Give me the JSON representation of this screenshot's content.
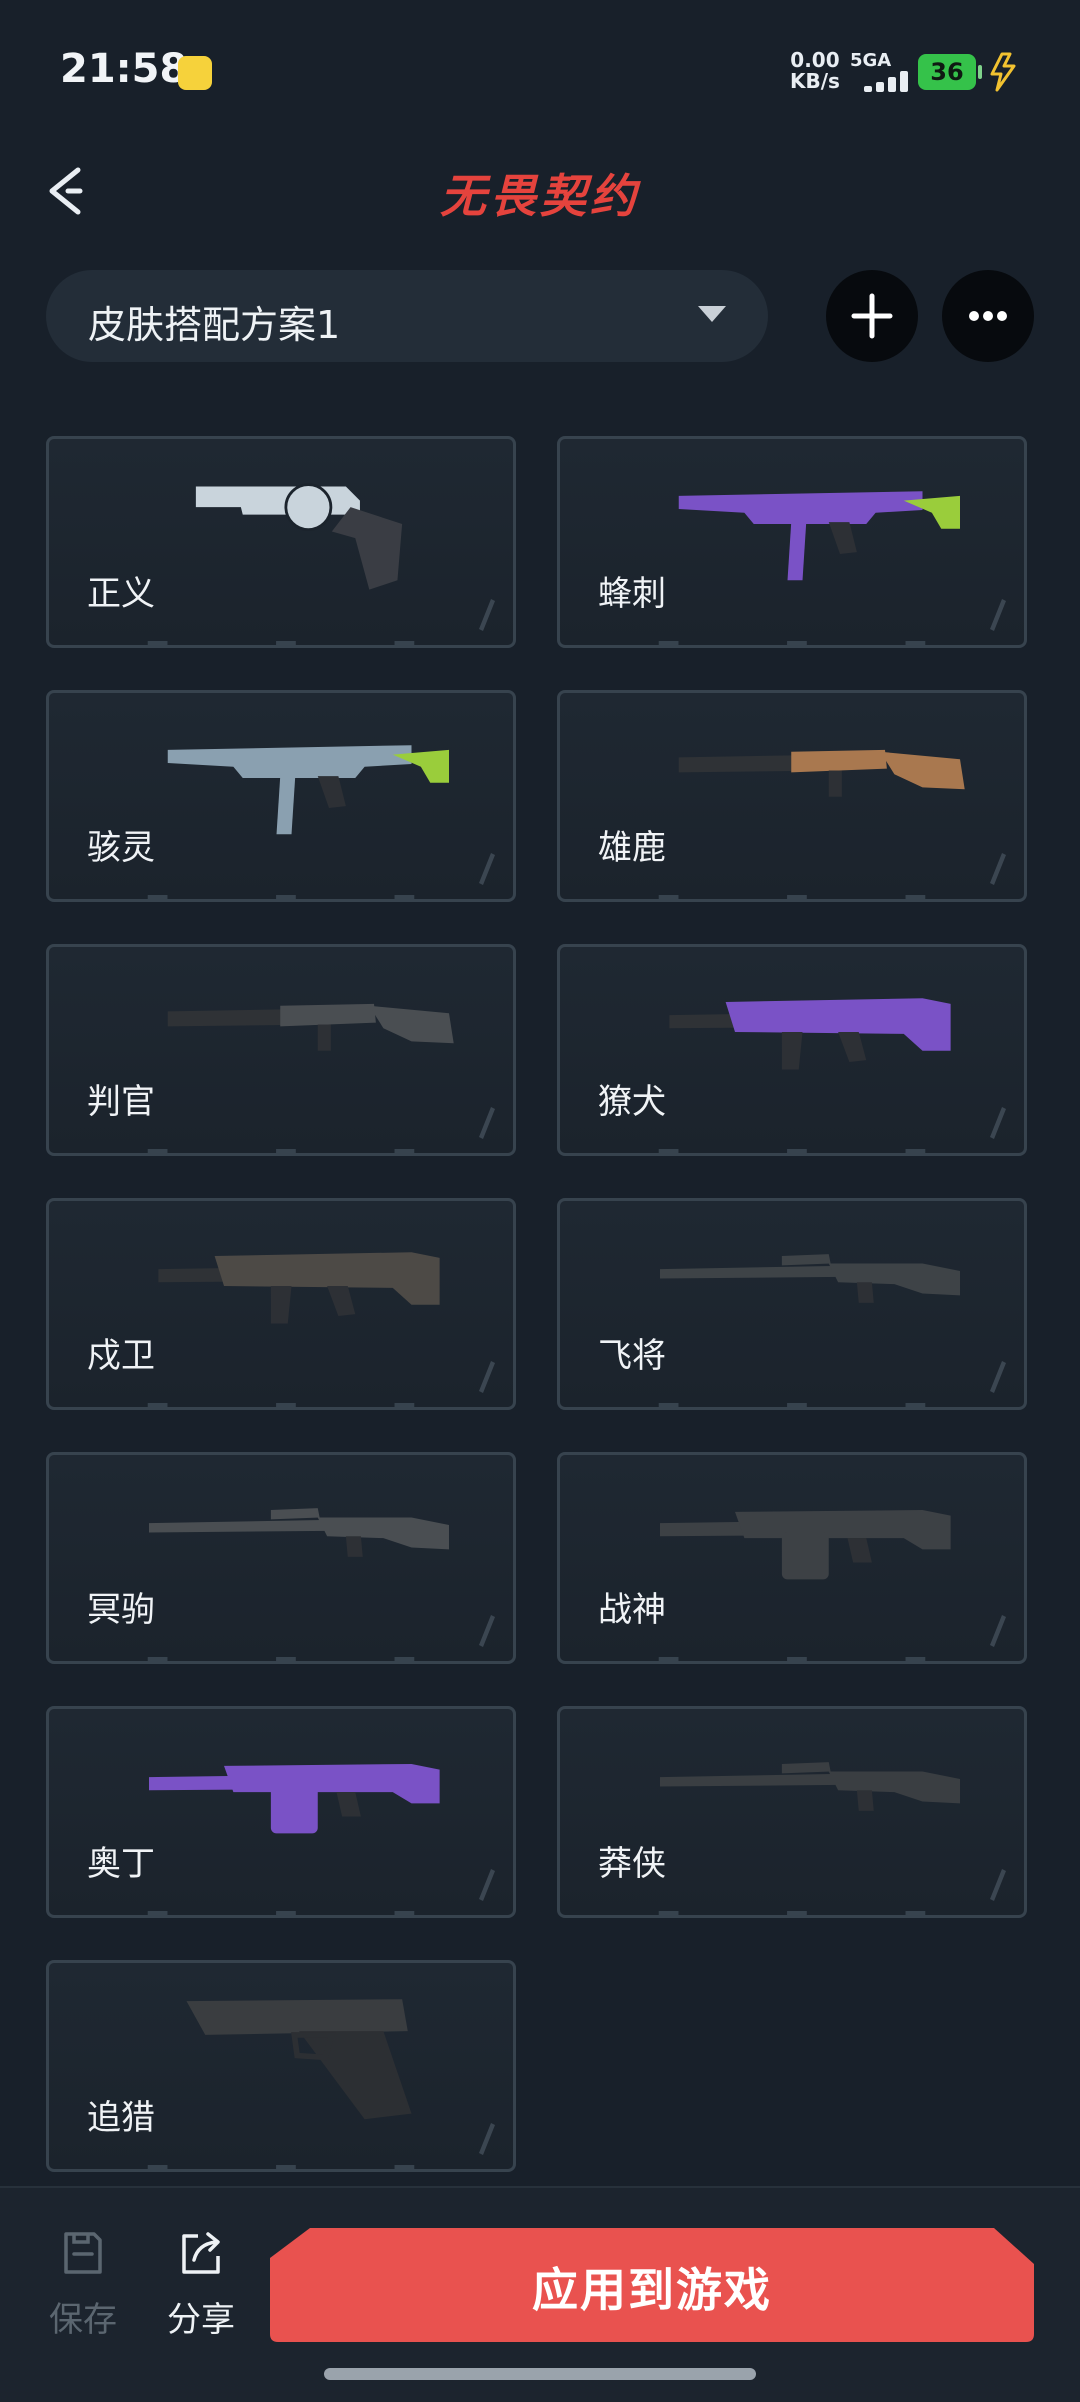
{
  "status_bar": {
    "time": "21:58",
    "net_speed_value": "0.00",
    "net_speed_unit": "KB/s",
    "signal_label": "5GA",
    "battery_level": "36"
  },
  "header": {
    "logo_text": "无畏契约"
  },
  "plan": {
    "current": "皮肤搭配方案1"
  },
  "weapons": [
    {
      "name": "正义",
      "icon": "revolver-icon",
      "color": "#c9d4dc"
    },
    {
      "name": "蜂刺",
      "icon": "smg-icon",
      "color": "#7a52c6"
    },
    {
      "name": "骇灵",
      "icon": "smg-icon",
      "color": "#8aa0b0"
    },
    {
      "name": "雄鹿",
      "icon": "shotgun-icon",
      "color": "#a9784f"
    },
    {
      "name": "判官",
      "icon": "shotgun-icon",
      "color": "#4a4e52"
    },
    {
      "name": "獠犬",
      "icon": "rifle-icon",
      "color": "#7a52c6"
    },
    {
      "name": "戍卫",
      "icon": "rifle-icon",
      "color": "#4d4a46"
    },
    {
      "name": "飞将",
      "icon": "sniper-icon",
      "color": "#3e4347"
    },
    {
      "name": "冥驹",
      "icon": "sniper-icon",
      "color": "#4a4e52"
    },
    {
      "name": "战神",
      "icon": "machine-gun-icon",
      "color": "#3d4145"
    },
    {
      "name": "奥丁",
      "icon": "machine-gun-icon",
      "color": "#7a52c6"
    },
    {
      "name": "莽侠",
      "icon": "sniper-icon",
      "color": "#3a3e42"
    },
    {
      "name": "追猎",
      "icon": "pistol-icon",
      "color": "#3a3d40"
    }
  ],
  "bottom_bar": {
    "save_label": "保存",
    "share_label": "分享",
    "apply_label": "应用到游戏"
  },
  "colors": {
    "background": "#18202a",
    "accent": "#e9524f",
    "battery": "#35c24a"
  }
}
